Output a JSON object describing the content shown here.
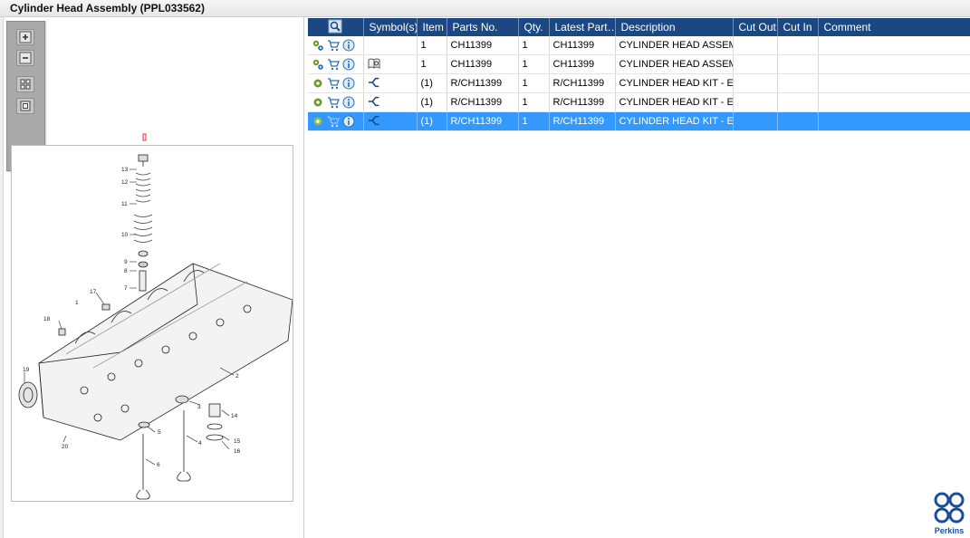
{
  "window": {
    "title": "Cylinder Head Assembly (PPL033562)"
  },
  "diagram": {
    "callouts": [
      "13",
      "12",
      "11",
      "10",
      "9",
      "8",
      "7",
      "17",
      "18",
      "19",
      "2",
      "3",
      "14",
      "15",
      "16",
      "5",
      "4",
      "6",
      "20",
      "1"
    ]
  },
  "zoom_toolbar": {
    "buttons": [
      "zoom-in-icon",
      "zoom-out-icon",
      "fit-grid-icon",
      "actual-size-icon",
      "expand-icon"
    ]
  },
  "table": {
    "headers": [
      "",
      "Symbol(s)",
      "Item",
      "Parts No.",
      "Qty.",
      "Latest Part…",
      "Description",
      "Cut Out",
      "Cut In",
      "Comment"
    ],
    "rows": [
      {
        "item": "1",
        "parts_no": "CH11399",
        "qty": "1",
        "latest": "CH11399",
        "description": "CYLINDER HEAD ASSEMB",
        "cut_out": "",
        "cut_in": "",
        "comment": "",
        "symbol": "",
        "status": "gears-icon",
        "selected": false
      },
      {
        "item": "1",
        "parts_no": "CH11399",
        "qty": "1",
        "latest": "CH11399",
        "description": "CYLINDER HEAD ASSEMB",
        "cut_out": "",
        "cut_in": "",
        "comment": "",
        "symbol": "book-icon",
        "status": "gears-icon",
        "selected": false
      },
      {
        "item": "(1)",
        "parts_no": "R/CH11399",
        "qty": "1",
        "latest": "R/CH11399",
        "description": "CYLINDER HEAD KIT - EXC",
        "cut_out": "",
        "cut_in": "",
        "comment": "",
        "symbol": "branch-icon",
        "status": "gear-icon",
        "selected": false
      },
      {
        "item": "(1)",
        "parts_no": "R/CH11399",
        "qty": "1",
        "latest": "R/CH11399",
        "description": "CYLINDER HEAD KIT - EXC",
        "cut_out": "",
        "cut_in": "",
        "comment": "",
        "symbol": "branch-icon",
        "status": "gear-icon",
        "selected": false
      },
      {
        "item": "(1)",
        "parts_no": "R/CH11399",
        "qty": "1",
        "latest": "R/CH11399",
        "description": "CYLINDER HEAD KIT - EXC",
        "cut_out": "",
        "cut_in": "",
        "comment": "",
        "symbol": "branch-icon",
        "status": "gear-icon",
        "selected": true
      }
    ]
  },
  "brand": {
    "name": "Perkins",
    "color": "#1b4f9c"
  },
  "colors": {
    "header": "#1b4883",
    "selected": "#3399ff"
  }
}
